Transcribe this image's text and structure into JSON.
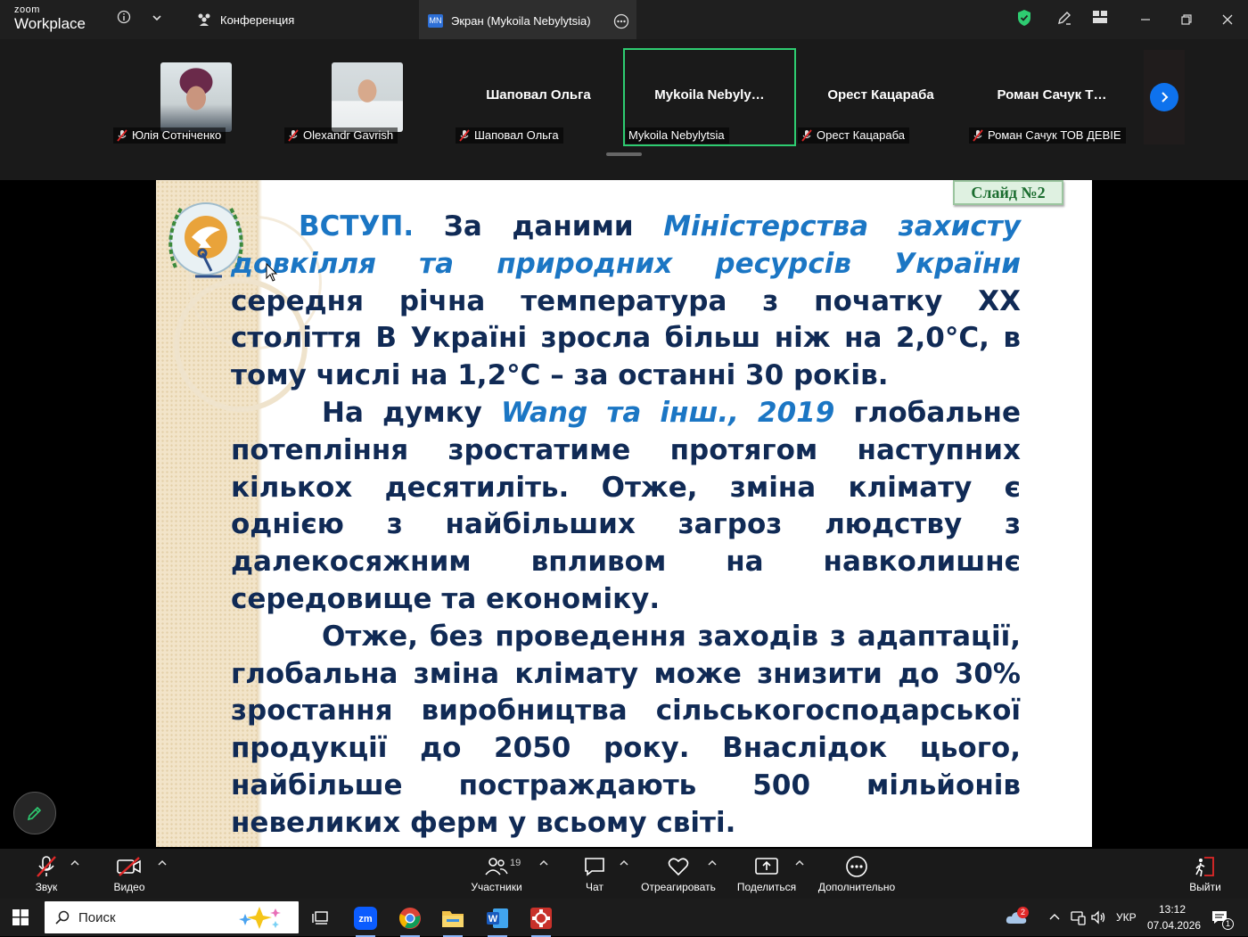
{
  "titlebar": {
    "brand_top": "zoom",
    "brand_bottom": "Workplace",
    "tabs": [
      {
        "label": "Конференция",
        "icon": "participants-icon"
      },
      {
        "label": "Экран (Mykoila Nebylytsia)",
        "badge": "MN",
        "active": true
      }
    ],
    "colors": {
      "accent": "#0e72ed",
      "shield": "#2ecc71"
    }
  },
  "gallery": {
    "tiles": [
      {
        "display": "photo",
        "name": "Юлія Сотніченко",
        "muted": true
      },
      {
        "display": "photo",
        "name": "Olexandr Gavrish",
        "muted": true
      },
      {
        "display": "name",
        "big": "Шаповал Ольга",
        "name": "Шаповал Ольга",
        "muted": true
      },
      {
        "display": "name",
        "big": "Mykoila  Nebyly…",
        "name": "Mykoila Nebylytsia",
        "muted": false,
        "speaking": true
      },
      {
        "display": "name",
        "big": "Орест Кацараба",
        "name": "Орест Кацараба",
        "muted": true
      },
      {
        "display": "name",
        "big": "Роман Сачук Т…",
        "name": "Роман Сачук ТОВ ДЕВІЕ",
        "muted": true
      }
    ]
  },
  "slide": {
    "number": "Слайд №2",
    "p1": {
      "lead": "ВСТУП.",
      "a": " За даними ",
      "source": "Міністерства захисту довкілля та природних ресурсів України",
      "b": " середня річна температура з початку ХХ століття В Україні зросла більш ніж на 2,0°С, в тому числі на 1,2°С – за останні 30 років."
    },
    "p2": {
      "a": "На думку ",
      "source": "Wang та інш., 2019",
      "b": " глобальне потепління зростатиме протягом наступних кількох десятиліть. Отже, зміна клімату є однією з найбільших загроз людству з далекосяжним впливом на навколишнє середовище та економіку."
    },
    "p3": "Отже, без проведення заходів з адаптації, глобальна зміна клімату може знизити до 30% зростання виробництва сільськогосподарської продукції до 2050 року. Внаслідок цього, найбільше постраждають 500 мільйонів невеликих ферм у всьому світі."
  },
  "toolbar": {
    "audio": "Звук",
    "video": "Видео",
    "participants": "Участники",
    "participants_count": "19",
    "chat": "Чат",
    "react": "Отреагировать",
    "share": "Поделиться",
    "more": "Дополнительно",
    "leave": "Выйти"
  },
  "taskbar": {
    "search_placeholder": "Поиск",
    "apps": [
      "task-view-icon",
      "zoom-app-icon",
      "chrome-app-icon",
      "file-explorer-icon",
      "word-app-icon",
      "red-app-icon"
    ],
    "weather_badge": "2",
    "lang": "УКР",
    "time": "13:12",
    "date": "07.04.2026",
    "notification_count": "1"
  }
}
